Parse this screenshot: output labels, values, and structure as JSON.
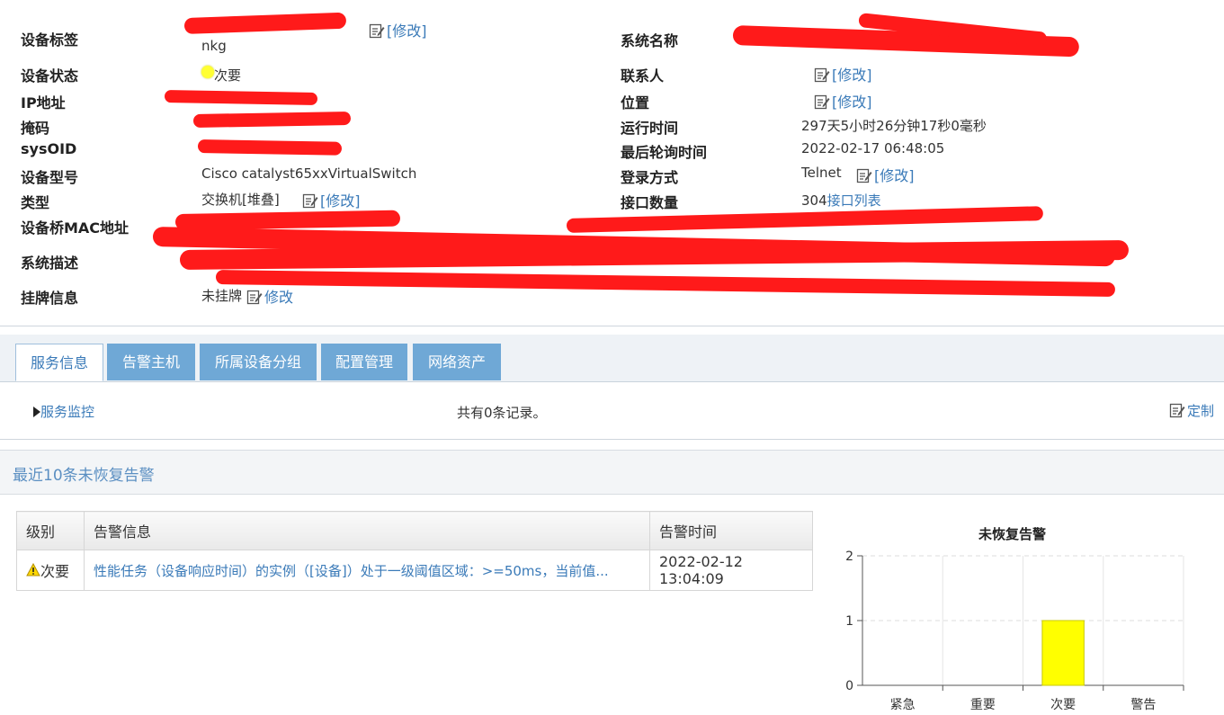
{
  "info": {
    "left": [
      {
        "label": "设备标签",
        "value": "nkg",
        "edit": "[修改]"
      },
      {
        "label": "设备状态",
        "value": "次要"
      },
      {
        "label": "IP地址",
        "value": ""
      },
      {
        "label": "掩码",
        "value": ""
      },
      {
        "label": "sysOID",
        "value": ""
      },
      {
        "label": "设备型号",
        "value": "Cisco catalyst65xxVirtualSwitch"
      },
      {
        "label": "类型",
        "value": "交换机[堆叠]",
        "edit": "[修改]"
      },
      {
        "label": "设备桥MAC地址",
        "value": ""
      },
      {
        "label": "系统描述",
        "value": ""
      },
      {
        "label": "挂牌信息",
        "value": "未挂牌",
        "edit": "修改"
      }
    ],
    "right": [
      {
        "label": "系统名称",
        "value": ""
      },
      {
        "label": "联系人",
        "value": "",
        "edit": "[修改]"
      },
      {
        "label": "位置",
        "value": "",
        "edit": "[修改]"
      },
      {
        "label": "运行时间",
        "value": "297天5小时26分钟17秒0毫秒"
      },
      {
        "label": "最后轮询时间",
        "value": "2022-02-17 06:48:05"
      },
      {
        "label": "登录方式",
        "value": "Telnet",
        "edit": "[修改]"
      },
      {
        "label": "接口数量",
        "value": "304",
        "link": "接口列表"
      }
    ]
  },
  "tabs": [
    "服务信息",
    "告警主机",
    "所属设备分组",
    "配置管理",
    "网络资产"
  ],
  "service": {
    "monitor_label": "服务监控",
    "record_count": "共有0条记录。",
    "customize": "定制"
  },
  "alarms_section": {
    "title": "最近10条未恢复告警",
    "columns": [
      "级别",
      "告警信息",
      "告警时间"
    ],
    "rows": [
      {
        "level": "次要",
        "message": "性能任务（设备响应时间）的实例（[设备]）处于一级阈值区域：>=50ms，当前值...",
        "time": "2022-02-12 13:04:09"
      }
    ]
  },
  "colors": {
    "status_minor": "#ffff00",
    "link": "#3a7ab8",
    "tab": "#6fa8d6"
  },
  "chart_data": {
    "type": "bar",
    "title": "未恢复告警",
    "categories": [
      "紧急",
      "重要",
      "次要",
      "警告"
    ],
    "values": [
      0,
      0,
      1,
      0
    ],
    "ylim": [
      0,
      2
    ],
    "yticks": [
      0,
      1,
      2
    ],
    "grid": true,
    "bar_color": "#ffff00"
  }
}
